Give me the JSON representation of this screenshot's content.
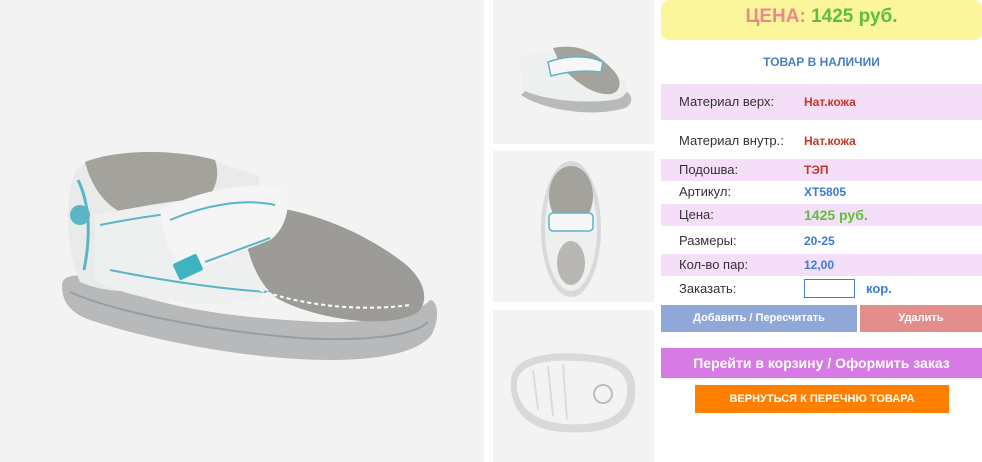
{
  "price_box": {
    "label": "ЦЕНА:",
    "value": "1425 руб."
  },
  "stock_status": "ТОВАР В НАЛИЧИИ",
  "specs": [
    {
      "label": "Материал верх:",
      "value": "Нат.кожа"
    },
    {
      "label": "Материал внутр.:",
      "value": "Нат.кожа"
    },
    {
      "label": "Подошва:",
      "value": "ТЭП"
    },
    {
      "label": "Артикул:",
      "value": "XT5805"
    },
    {
      "label": "Цена:",
      "value": "1425 руб."
    },
    {
      "label": "Размеры:",
      "value": "20-25"
    },
    {
      "label": "Кол-во пар:",
      "value": "12,00"
    }
  ],
  "order": {
    "label": "Заказать:",
    "unit": "кор.",
    "quantity": ""
  },
  "buttons": {
    "recalc": "Добавить / Пересчитать",
    "delete": "Удалить",
    "cart": "Перейти в корзину / Оформить заказ",
    "back": "ВЕРНУТЬСЯ К ПЕРЕЧНЮ ТОВАРА"
  },
  "colors": {
    "price_bg": "#fbf59b",
    "spec_row_bg": "#f5def7",
    "recalc_btn": "#8fa8d8",
    "delete_btn": "#e38d8c",
    "cart_btn": "#d77be4",
    "back_btn": "#ff7f00"
  },
  "images": {
    "main": "shoe-side-view-photo",
    "thumbs": [
      "shoe-angle-view-thumb",
      "shoe-top-view-thumb",
      "shoe-sole-view-thumb"
    ]
  }
}
